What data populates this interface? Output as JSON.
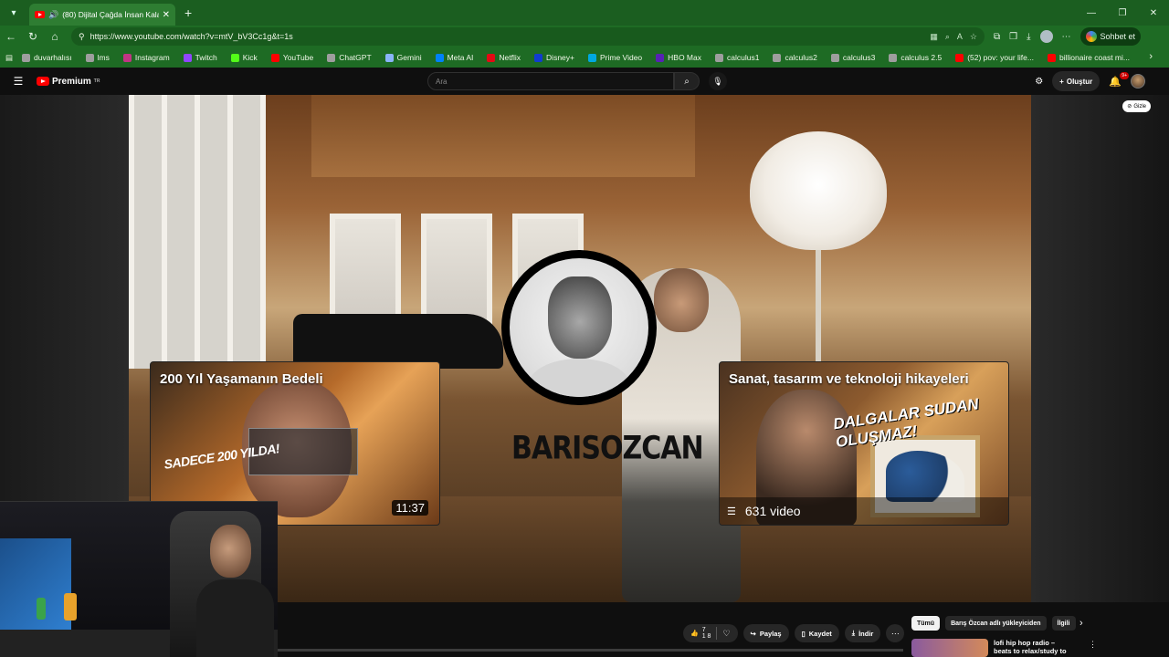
{
  "browser": {
    "tab_title": "(80) Dijital Çağda İnsan Kalab",
    "tab_close": "✕",
    "new_tab": "+",
    "url": "https://www.youtube.com/watch?v=mtV_bV3Cc1g&t=1s",
    "copilot_label": "Sohbet et",
    "bookmarks": [
      "duvarhalısı",
      "lms",
      "Instagram",
      "Twitch",
      "Kick",
      "YouTube",
      "ChatGPT",
      "Gemini",
      "Meta AI",
      "Netflix",
      "Disney+",
      "Prime Video",
      "HBO Max",
      "calculus1",
      "calculus2",
      "calculus3",
      "calculus 2.5",
      "(52) pov: your life...",
      "billionaire coast mi..."
    ],
    "bookmark_colors": [
      "#9e9e9e",
      "#9e9e9e",
      "#c13584",
      "#9146ff",
      "#53fc18",
      "#ff0000",
      "#9e9e9e",
      "#8ab4f8",
      "#0081fb",
      "#e50914",
      "#113ccf",
      "#00a8e1",
      "#5822b4",
      "#9e9e9e",
      "#9e9e9e",
      "#9e9e9e",
      "#9e9e9e",
      "#ff0000",
      "#ff0000"
    ]
  },
  "youtube": {
    "logo_text": "Premium",
    "logo_region": "TR",
    "search_placeholder": "Ara",
    "create_label": "Oluştur",
    "notification_count": "9+"
  },
  "player": {
    "hide_label": "Gizle",
    "channel_name": "BARISOZCAN",
    "video_card": {
      "title": "200 Yıl Yaşamanın Bedeli",
      "thumb_text": "SADECE 200 YILDA!",
      "duration": "11:37"
    },
    "playlist_card": {
      "title": "Sanat, tasarım ve teknoloji hikayeleri",
      "thumb_text": "DALGALAR SUDAN OLUŞMAZ!",
      "count": "631 video"
    }
  },
  "below_player": {
    "like_count_top": "7",
    "like_count_bottom": "1 8",
    "share_label": "Paylaş",
    "save_label": "Kaydet",
    "download_label": "İndir",
    "chips": [
      "Tümü",
      "Barış Özcan adlı yükleyiciden",
      "İlgili"
    ],
    "reco_title": "lofi hip hop radio – beats to relax/study to"
  },
  "colors": {
    "browser_green": "#1b5e20",
    "youtube_red": "#ff0000"
  }
}
